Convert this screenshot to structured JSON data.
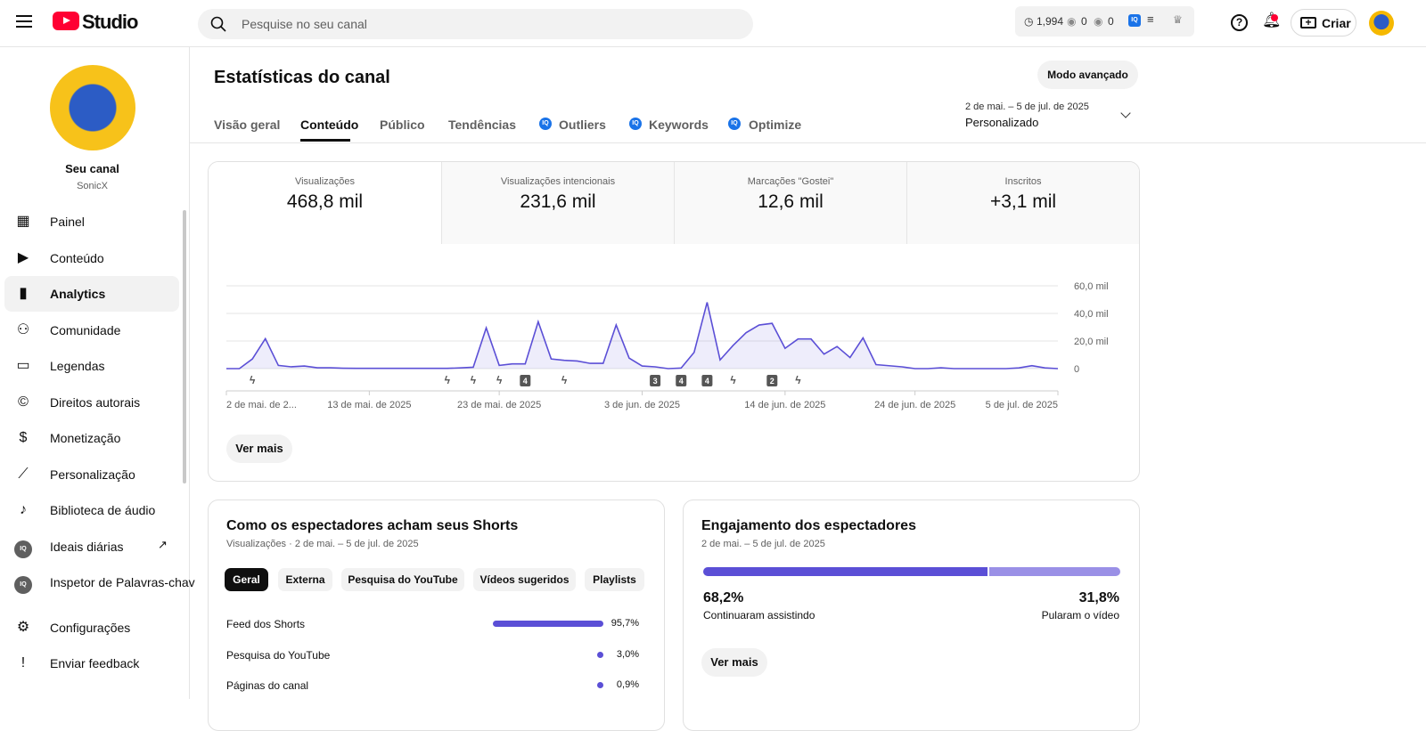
{
  "header": {
    "app_name": "Studio",
    "search_placeholder": "Pesquise no seu canal",
    "stat_time": "1,994",
    "stat_views1": "0",
    "stat_views2": "0",
    "create_label": "Criar",
    "iq_label": "IQ"
  },
  "sidebar": {
    "channel_title": "Seu canal",
    "channel_name": "SonicX",
    "items": [
      {
        "label": "Painel",
        "icon": "dashboard-icon"
      },
      {
        "label": "Conteúdo",
        "icon": "content-icon"
      },
      {
        "label": "Analytics",
        "icon": "analytics-icon"
      },
      {
        "label": "Comunidade",
        "icon": "community-icon"
      },
      {
        "label": "Legendas",
        "icon": "subtitles-icon"
      },
      {
        "label": "Direitos autorais",
        "icon": "copyright-icon"
      },
      {
        "label": "Monetização",
        "icon": "dollar-icon"
      },
      {
        "label": "Personalização",
        "icon": "magic-wand-icon"
      },
      {
        "label": "Biblioteca de áudio",
        "icon": "audio-library-icon"
      },
      {
        "label": "Ideais diárias",
        "icon": "vidiq-icon"
      },
      {
        "label": "Inspetor de Palavras-chav",
        "icon": "vidiq-icon"
      },
      {
        "label": "Configurações",
        "icon": "gear-icon"
      },
      {
        "label": "Enviar feedback",
        "icon": "feedback-icon"
      }
    ]
  },
  "main": {
    "title": "Estatísticas do canal",
    "advanced_mode": "Modo avançado",
    "tabs": [
      "Visão geral",
      "Conteúdo",
      "Público",
      "Tendências",
      "Outliers",
      "Keywords",
      "Optimize"
    ],
    "date_range": "2 de mai. – 5 de jul. de 2025",
    "date_preset": "Personalizado",
    "metrics": [
      {
        "title": "Visualizações",
        "value": "468,8 mil"
      },
      {
        "title": "Visualizações intencionais",
        "value": "231,6 mil"
      },
      {
        "title": "Marcações \"Gostei\"",
        "value": "12,6 mil"
      },
      {
        "title": "Inscritos",
        "value": "+3,1 mil"
      }
    ],
    "see_more": "Ver mais"
  },
  "chart_data": {
    "type": "area",
    "series": [
      {
        "name": "Visualizações",
        "values": [
          0,
          0,
          7,
          21.7,
          2.3,
          1.3,
          1.9,
          0.6,
          0.6,
          0.3,
          0.2,
          0.2,
          0.2,
          0.2,
          0.2,
          0.2,
          0.2,
          0.2,
          0.5,
          1,
          29.5,
          2.3,
          3.4,
          3.4,
          34,
          7,
          6,
          5.5,
          3.8,
          3.8,
          31.6,
          7.6,
          1.9,
          1.3,
          0,
          0.4,
          11.8,
          48,
          6.3,
          16.8,
          26,
          31.6,
          32.8,
          14.7,
          21.5,
          21.5,
          10.5,
          16,
          8,
          22.3,
          2.9,
          2.1,
          1.3,
          0,
          0,
          0.6,
          0,
          0,
          0,
          0,
          0,
          0.5,
          2.1,
          0.5,
          0
        ]
      }
    ],
    "unit": "mil",
    "ylim": [
      0,
      60
    ],
    "yticks": [
      "60,0 mil",
      "40,0 mil",
      "20,0 mil",
      "0"
    ],
    "xticks": [
      {
        "i": 0,
        "label": "2 de mai. de 2..."
      },
      {
        "i": 11,
        "label": "13 de mai. de 2025"
      },
      {
        "i": 21,
        "label": "23 de mai. de 2025"
      },
      {
        "i": 32,
        "label": "3 de jun. de 2025"
      },
      {
        "i": 43,
        "label": "14 de jun. de 2025"
      },
      {
        "i": 53,
        "label": "24 de jun. de 2025"
      },
      {
        "i": 64,
        "label": "5 de jul. de 2025"
      }
    ],
    "markers": [
      {
        "i": 2,
        "label": ""
      },
      {
        "i": 17,
        "label": ""
      },
      {
        "i": 19,
        "label": ""
      },
      {
        "i": 21,
        "label": ""
      },
      {
        "i": 23,
        "label": "4"
      },
      {
        "i": 26,
        "label": ""
      },
      {
        "i": 33,
        "label": "3"
      },
      {
        "i": 35,
        "label": "4"
      },
      {
        "i": 37,
        "label": "4"
      },
      {
        "i": 39,
        "label": ""
      },
      {
        "i": 42,
        "label": "2"
      },
      {
        "i": 44,
        "label": ""
      }
    ],
    "color": "#5b4fd6"
  },
  "shorts_card": {
    "title": "Como os espectadores acham seus Shorts",
    "subtitle": "Visualizações · 2 de mai. – 5 de jul. de 2025",
    "chips": [
      "Geral",
      "Externa",
      "Pesquisa do YouTube",
      "Vídeos sugeridos",
      "Playlists"
    ],
    "rows": [
      {
        "label": "Feed dos Shorts",
        "value": "95,7%",
        "pct": 95.7
      },
      {
        "label": "Pesquisa do YouTube",
        "value": "3,0%",
        "pct": 3.0
      },
      {
        "label": "Páginas do canal",
        "value": "0,9%",
        "pct": 0.9
      }
    ]
  },
  "engagement_card": {
    "title": "Engajamento dos espectadores",
    "subtitle": "2 de mai. – 5 de jul. de 2025",
    "continued_pct": "68,2%",
    "continued_label": "Continuaram assistindo",
    "skipped_pct": "31,8%",
    "skipped_label": "Pularam o vídeo",
    "continued_fraction": 0.682,
    "see_more": "Ver mais"
  }
}
